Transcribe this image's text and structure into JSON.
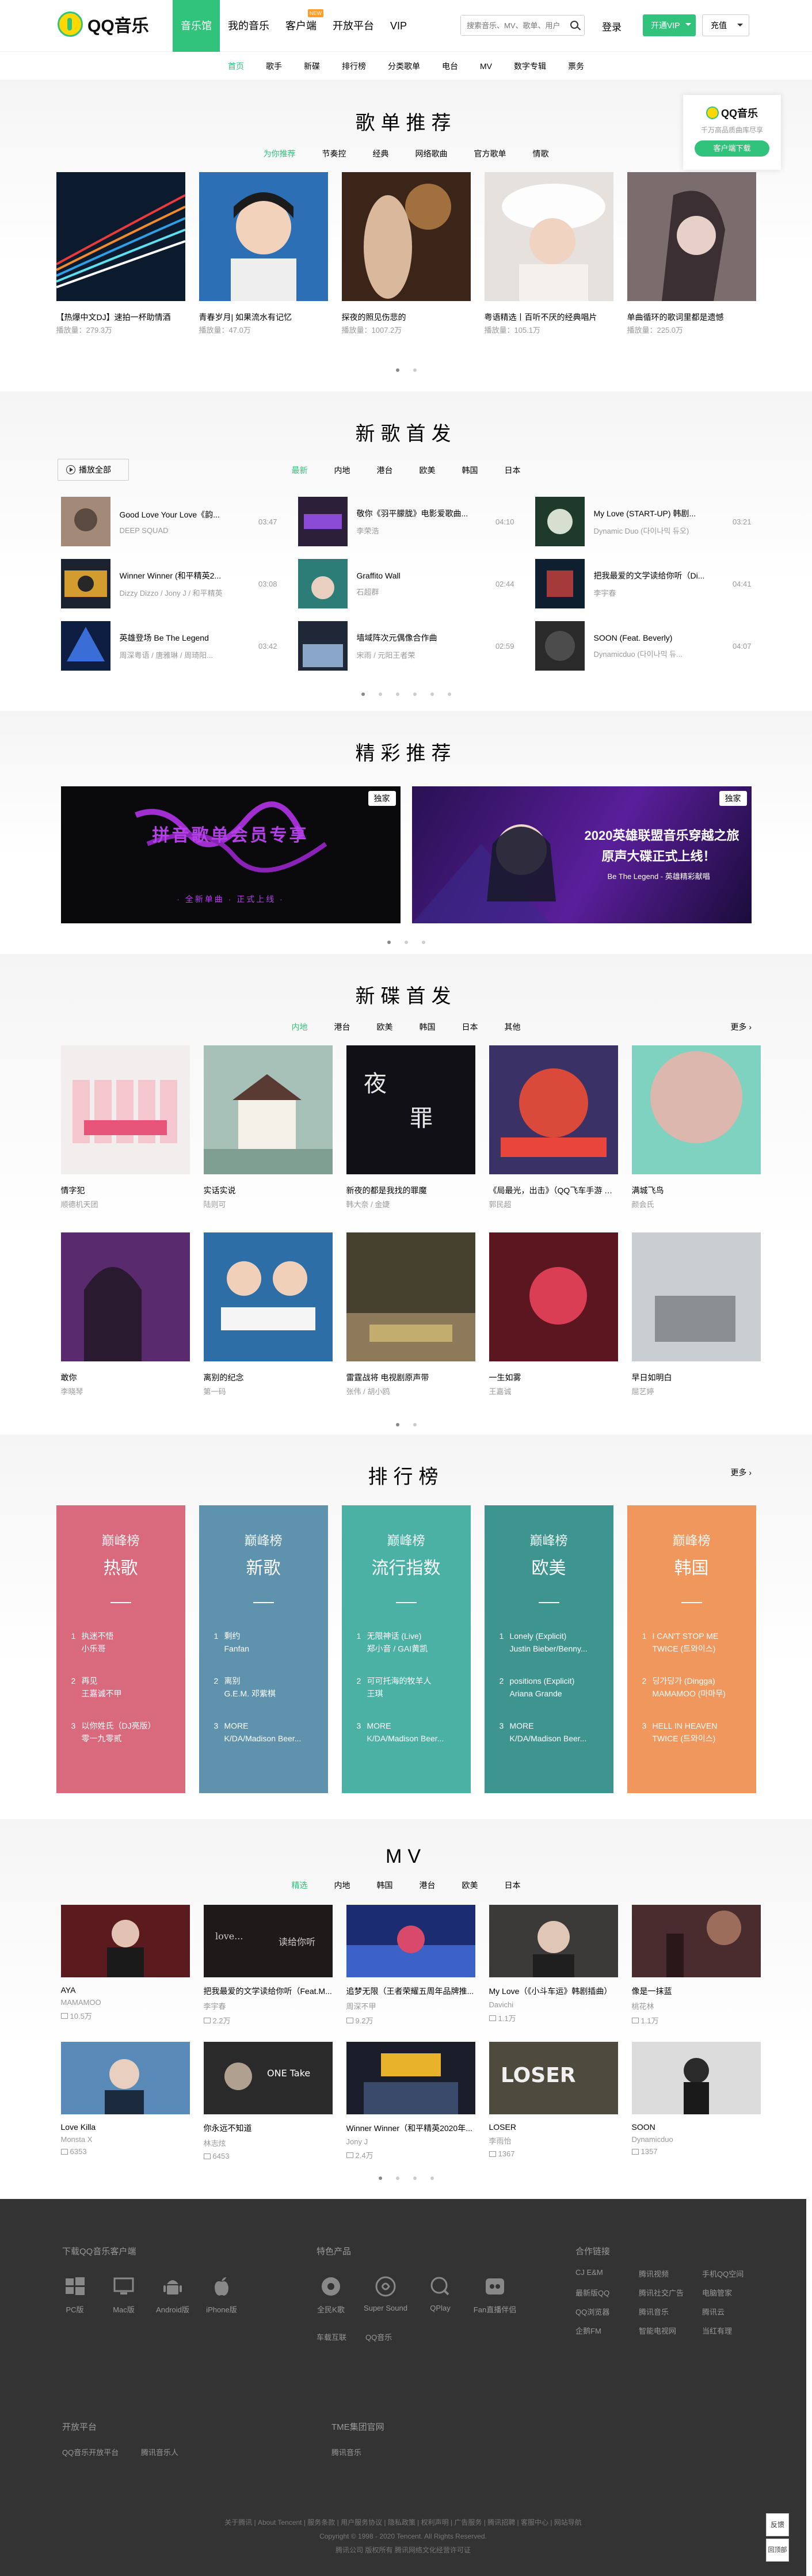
{
  "header": {
    "logo_text": "QQ音乐",
    "nav": [
      {
        "label": "音乐馆",
        "active": true
      },
      {
        "label": "我的音乐"
      },
      {
        "label": "客户端",
        "badge": "NEW"
      },
      {
        "label": "开放平台"
      },
      {
        "label": "VIP"
      }
    ],
    "search_placeholder": "搜索音乐、MV、歌单、用户",
    "login": "登录",
    "vip_button": "开通VIP",
    "recharge_button": "充值"
  },
  "subnav": [
    "首页",
    "歌手",
    "新碟",
    "排行榜",
    "分类歌单",
    "电台",
    "MV",
    "数字专辑",
    "票务"
  ],
  "sticky_ad": {
    "logo": "QQ音乐",
    "sub": "千万高品质曲库尽享",
    "button": "客户端下载"
  },
  "playlists": {
    "title": "歌单推荐",
    "tabs": [
      "为你推荐",
      "节奏控",
      "经典",
      "网络歌曲",
      "官方歌单",
      "情歌"
    ],
    "items": [
      {
        "title": "【热爆中文DJ】速拍一杯助情酒",
        "plays": "播放量：279.3万"
      },
      {
        "title": "青春岁月| 如果流水有记忆",
        "plays": "播放量：47.0万"
      },
      {
        "title": "探夜的照见伤悲的",
        "plays": "播放量：1007.2万"
      },
      {
        "title": "粤语精选丨百听不厌的经典唱片",
        "plays": "播放量：105.1万"
      },
      {
        "title": "单曲循环的歌词里都是遗憾",
        "plays": "播放量：225.0万"
      }
    ]
  },
  "new_songs": {
    "title": "新歌首发",
    "play_all": "播放全部",
    "tabs": [
      "最新",
      "内地",
      "港台",
      "欧美",
      "韩国",
      "日本"
    ],
    "items": [
      {
        "name": "Good Love Your Love《韵...",
        "singer": "DEEP SQUAD",
        "time": "03:47"
      },
      {
        "name": "敬你《羽平朦胧》电影爱歌曲...",
        "singer": "李荣浩",
        "time": "04:10"
      },
      {
        "name": "My Love (START-UP) 韩剧...",
        "singer": "Dynamic Duo (다이나믹 듀오)",
        "time": "03:21"
      },
      {
        "name": "Winner Winner (和平精英2...",
        "singer": "Dizzy Dizzo / Jony J / 和平精英",
        "time": "03:08"
      },
      {
        "name": "Graffito Wall",
        "singer": "石超群",
        "time": "02:44"
      },
      {
        "name": "把我最爱的文学读给你听（Di...",
        "singer": "李宇春",
        "time": "04:41"
      },
      {
        "name": "英雄登场 Be The Legend",
        "singer": "周深粤语 / 唐雅琳 / 周琦阳...",
        "time": "03:42"
      },
      {
        "name": "墙域阵次元偶像合作曲",
        "singer": "宋雨 / 元阳王者荣",
        "time": "02:59"
      },
      {
        "name": "SOON (Feat. Beverly)",
        "singer": "Dynamicduo (다이나믹 듀...",
        "time": "04:07"
      }
    ]
  },
  "featured": {
    "title": "精彩推荐",
    "items": [
      {
        "tag": "独家",
        "text1": "拼音歌单会员专享",
        "text2": "· 全新单曲 · 正式上线 ·"
      },
      {
        "tag": "独家",
        "text1": "2020英雄联盟音乐穿越之旅",
        "text2": "原声大碟正式上线！",
        "text3": "Be The Legend - 英雄精彩献唱"
      }
    ]
  },
  "new_albums": {
    "title": "新碟首发",
    "more": "更多",
    "tabs": [
      "内地",
      "港台",
      "欧美",
      "韩国",
      "日本",
      "其他"
    ],
    "items": [
      {
        "title": "情字犯",
        "artist": "顺德机天团"
      },
      {
        "title": "实话实说",
        "artist": "陆则可"
      },
      {
        "title": "新夜的都是我找的罪魔",
        "artist": "韩大奈 / 金婕"
      },
      {
        "title": "《局最光，出击》（QQ飞车手游 X 奥特曼系列推广曲）",
        "artist": "郭民超"
      },
      {
        "title": "满城飞鸟",
        "artist": "颜会氏"
      },
      {
        "title": "敢你",
        "artist": "李晓琴"
      },
      {
        "title": "离别的纪念",
        "artist": "第一码"
      },
      {
        "title": "雷霆战将 电视剧原声带",
        "artist": "张伟 / 胡小鸥"
      },
      {
        "title": "一生如雾",
        "artist": "王嘉诚"
      },
      {
        "title": "早日如明白",
        "artist": "屈艺婷"
      }
    ]
  },
  "toplist": {
    "title": "排行榜",
    "more": "更多",
    "lists": [
      {
        "h1": "巅峰榜",
        "h2": "热歌",
        "color": "#d9697c",
        "items": [
          {
            "n": "1",
            "s": "执迷不悟",
            "a": "小乐哥"
          },
          {
            "n": "2",
            "s": "再见",
            "a": "王嘉诚不甲"
          },
          {
            "n": "3",
            "s": "以你姓氏（DJ亮版）",
            "a": "零一九零贰"
          }
        ]
      },
      {
        "h1": "巅峰榜",
        "h2": "新歌",
        "color": "#5f92ac",
        "items": [
          {
            "n": "1",
            "s": "剩约",
            "a": "Fanfan"
          },
          {
            "n": "2",
            "s": "离别",
            "a": "G.E.M. 邓紫棋"
          },
          {
            "n": "3",
            "s": "MORE",
            "a": "K/DA/Madison Beer..."
          }
        ]
      },
      {
        "h1": "巅峰榜",
        "h2": "流行指数",
        "color": "#4bb1a5",
        "items": [
          {
            "n": "1",
            "s": "无限神话 (Live)",
            "a": "郑小音 / GAI黄凯"
          },
          {
            "n": "2",
            "s": "可可托海的牧羊人",
            "a": "王琪"
          },
          {
            "n": "3",
            "s": "MORE",
            "a": "K/DA/Madison Beer..."
          }
        ]
      },
      {
        "h1": "巅峰榜",
        "h2": "欧美",
        "color": "#3e9590",
        "items": [
          {
            "n": "1",
            "s": "Lonely (Explicit)",
            "a": "Justin Bieber/Benny..."
          },
          {
            "n": "2",
            "s": "positions (Explicit)",
            "a": "Ariana Grande"
          },
          {
            "n": "3",
            "s": "MORE",
            "a": "K/DA/Madison Beer..."
          }
        ]
      },
      {
        "h1": "巅峰榜",
        "h2": "韩国",
        "color": "#f0975e",
        "items": [
          {
            "n": "1",
            "s": "I CAN'T STOP ME",
            "a": "TWICE (트와이스)"
          },
          {
            "n": "2",
            "s": "딩가딩가 (Dingga)",
            "a": "MAMAMOO (마마무)"
          },
          {
            "n": "3",
            "s": "HELL IN HEAVEN",
            "a": "TWICE (트와이스)"
          }
        ]
      }
    ]
  },
  "mv": {
    "title": "MV",
    "tabs": [
      "精选",
      "内地",
      "韩国",
      "港台",
      "欧美",
      "日本"
    ],
    "items": [
      {
        "title": "AYA",
        "artist": "MAMAMOO",
        "plays": "10.5万"
      },
      {
        "title": "把我最爱的文学读给你听（Feat.M...",
        "artist": "李宇春",
        "plays": "2.2万"
      },
      {
        "title": "追梦无限（王者荣耀五周年品牌推...",
        "artist": "周深不甲",
        "plays": "9.2万"
      },
      {
        "title": "My Love（《小斗车运》韩剧插曲）",
        "artist": "Davichi",
        "plays": "1.1万"
      },
      {
        "title": "像是一抹蓝",
        "artist": "桃花林",
        "plays": "1.1万"
      },
      {
        "title": "Love Killa",
        "artist": "Monsta X",
        "plays": "6353"
      },
      {
        "title": "你永远不知道",
        "artist": "林志炫",
        "plays": "6453"
      },
      {
        "title": "Winner Winner（和平精英2020年...",
        "artist": "Jony J",
        "plays": "2.4万"
      },
      {
        "title": "LOSER",
        "artist": "李雨怡",
        "plays": "1367"
      },
      {
        "title": "SOON",
        "artist": "Dynamicduo",
        "plays": "1357"
      }
    ]
  },
  "footer": {
    "download_title": "下载QQ音乐客户端",
    "downloads": [
      "PC版",
      "Mac版",
      "Android版",
      "iPhone版"
    ],
    "products_title": "特色产品",
    "products": [
      "全民K歌",
      "Super Sound",
      "QPlay",
      "Fan直播伴侣",
      "车载互联",
      "QQ音乐"
    ],
    "partners_title": "合作链接",
    "partners": [
      "CJ E&M",
      "腾讯视频",
      "手机QQ空间",
      "最新版QQ",
      "腾讯社交广告",
      "电脑管家",
      "QQ浏览器",
      "腾讯音乐",
      "腾讯云",
      "企鹅FM",
      "智能电视网",
      "当红有理"
    ],
    "open_title": "开放平台",
    "open_links": [
      "QQ音乐开放平台",
      "腾讯音乐人"
    ],
    "tme_title": "TME集团官网",
    "tme_links": [
      "腾讯音乐"
    ],
    "bottom1": "关于腾讯 | About Tencent | 服务条款 | 用户服务协议 | 隐私政策 | 权利声明 | 广告服务 | 腾讯招聘 | 客服中心 | 网站导航",
    "bottom2": "Copyright © 1998 - 2020 Tencent. All Rights Reserved.",
    "bottom3": "腾讯公司 版权所有 腾讯网络文化经营许可证",
    "feedback": "反馈",
    "top": "回顶部"
  }
}
